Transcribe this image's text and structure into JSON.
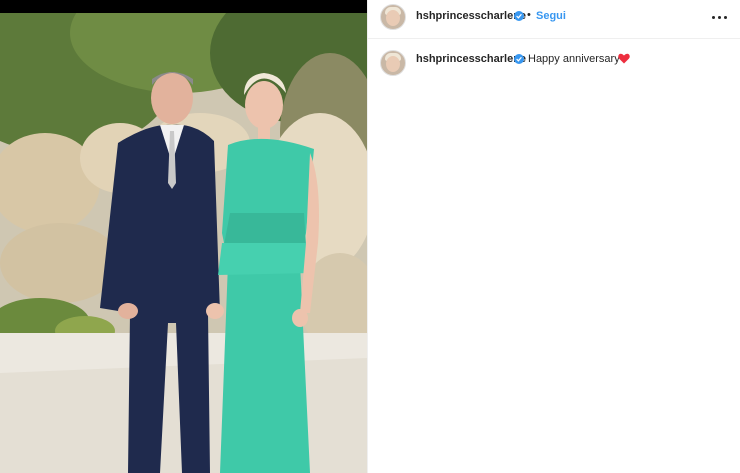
{
  "post": {
    "username": "hshprincesscharlene",
    "verified": true,
    "follow_label": "Segui",
    "separator": "•",
    "caption": {
      "username": "hshprincesscharlene",
      "text": "Happy anniversary",
      "emoji": "heart-emoji"
    }
  },
  "colors": {
    "accent": "#3897f0",
    "text": "#262626",
    "heart": "#ed2e3f"
  }
}
